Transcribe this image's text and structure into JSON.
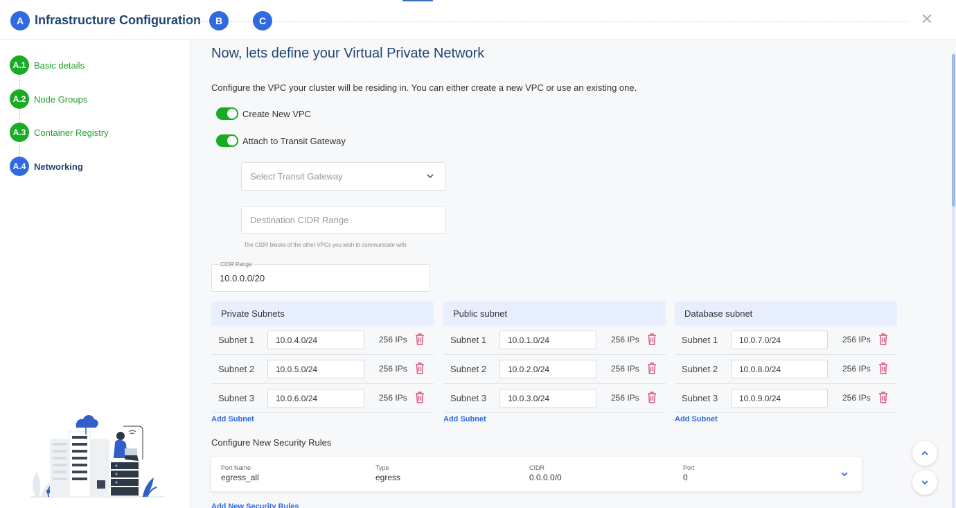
{
  "header": {
    "step_a": "A",
    "title": "Infrastructure Configuration",
    "step_b": "B",
    "step_c": "C",
    "close": "✕"
  },
  "sidebar": {
    "items": [
      {
        "badge": "A.1",
        "label": "Basic details",
        "state": "done"
      },
      {
        "badge": "A.2",
        "label": "Node Groups",
        "state": "done"
      },
      {
        "badge": "A.3",
        "label": "Container Registry",
        "state": "done"
      },
      {
        "badge": "A.4",
        "label": "Networking",
        "state": "current"
      }
    ],
    "illustration_icon": "server-person-illustration"
  },
  "main": {
    "title": "Now, lets define your Virtual Private Network",
    "description": "Configure the VPC your cluster will be residing in. You can either create a new VPC or use an existing one.",
    "toggles": [
      {
        "label": "Create New VPC",
        "on": true
      },
      {
        "label": "Attach to Transit Gateway",
        "on": true
      }
    ],
    "transit_gateway_placeholder": "Select Transit Gateway",
    "destination_cidr_placeholder": "Destination CIDR Range",
    "destination_helper": "The CIDR blocks of the other VPCs you wish to communicate with.",
    "cidr_label": "CIDR Range",
    "cidr_value": "10.0.0.0/20",
    "subnet_panels": [
      {
        "title": "Private Subnets",
        "rows": [
          {
            "name": "Subnet 1",
            "cidr": "10.0.4.0/24",
            "ips": "256 IPs"
          },
          {
            "name": "Subnet 2",
            "cidr": "10.0.5.0/24",
            "ips": "256 IPs"
          },
          {
            "name": "Subnet 3",
            "cidr": "10.0.6.0/24",
            "ips": "256 IPs"
          }
        ],
        "add_label": "Add Subnet"
      },
      {
        "title": "Public subnet",
        "rows": [
          {
            "name": "Subnet 1",
            "cidr": "10.0.1.0/24",
            "ips": "256 IPs"
          },
          {
            "name": "Subnet 2",
            "cidr": "10.0.2.0/24",
            "ips": "256 IPs"
          },
          {
            "name": "Subnet 3",
            "cidr": "10.0.3.0/24",
            "ips": "256 IPs"
          }
        ],
        "add_label": "Add Subnet"
      },
      {
        "title": "Database subnet",
        "rows": [
          {
            "name": "Subnet 1",
            "cidr": "10.0.7.0/24",
            "ips": "256 IPs"
          },
          {
            "name": "Subnet 2",
            "cidr": "10.0.8.0/24",
            "ips": "256 IPs"
          },
          {
            "name": "Subnet 3",
            "cidr": "10.0.9.0/24",
            "ips": "256 IPs"
          }
        ],
        "add_label": "Add Subnet"
      }
    ],
    "security": {
      "title": "Configure New Security Rules",
      "rule": {
        "port_name_label": "Port Name",
        "port_name": "egress_all",
        "type_label": "Type",
        "type": "egress",
        "cidr_label": "CIDR",
        "cidr": "0.0.0.0/0",
        "port_label": "Port",
        "port": "0"
      },
      "add_label": "Add New Security Rules"
    }
  },
  "colors": {
    "accent": "#2f6ae0",
    "success": "#1aab24",
    "title": "#1f4473",
    "danger": "#d9537f",
    "subnet_header_bg": "#e7efff"
  }
}
